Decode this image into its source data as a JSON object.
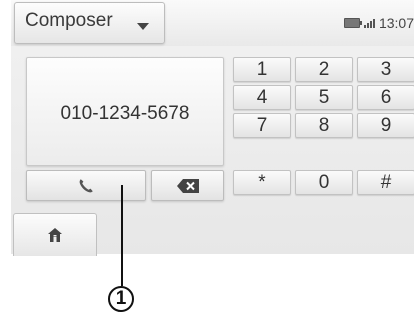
{
  "header": {
    "mode_label": "Composer",
    "time": "13:07"
  },
  "display": {
    "number": "010-1234-5678"
  },
  "keypad": {
    "keys": [
      "1",
      "2",
      "3",
      "4",
      "5",
      "6",
      "7",
      "8",
      "9",
      "*",
      "0",
      "#"
    ]
  },
  "callout": {
    "number": "1"
  },
  "icons": {
    "call": "phone-handset-icon",
    "delete": "backspace-icon",
    "home": "home-icon",
    "battery": "battery-icon",
    "signal": "signal-icon",
    "dropdown": "chevron-down-icon"
  }
}
